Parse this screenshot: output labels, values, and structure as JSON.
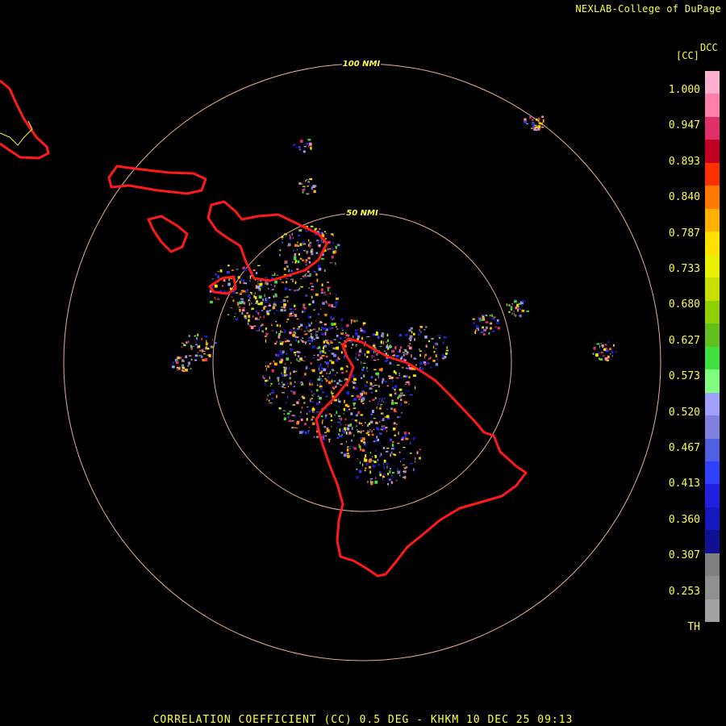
{
  "header": {
    "credit": "NEXLAB-College of DuPage"
  },
  "rings": [
    {
      "label": "100 NMI"
    },
    {
      "label": "50 NMI"
    }
  ],
  "legend": {
    "unit": "[CC]",
    "code": "DCC",
    "ticks": [
      "1.000",
      "0.947",
      "0.893",
      "0.840",
      "0.787",
      "0.733",
      "0.680",
      "0.627",
      "0.573",
      "0.520",
      "0.467",
      "0.413",
      "0.360",
      "0.307",
      "0.253",
      "TH"
    ],
    "colors": [
      "#ffb0d0",
      "#ff80a8",
      "#e0306a",
      "#c00020",
      "#ff3000",
      "#ff7800",
      "#ffb000",
      "#ffe000",
      "#e8f000",
      "#c8e000",
      "#90d000",
      "#60c020",
      "#40e040",
      "#80ff80",
      "#a0a0ff",
      "#8080e0",
      "#5060e0",
      "#3040ff",
      "#2020e0",
      "#1818c0",
      "#101090",
      "#808080",
      "#909090",
      "#a0a0a0",
      "#000000"
    ]
  },
  "footer": {
    "title": "CORRELATION COEFFICIENT (CC) 0.5 DEG - KHKM 10 DEC 25 09:13"
  }
}
